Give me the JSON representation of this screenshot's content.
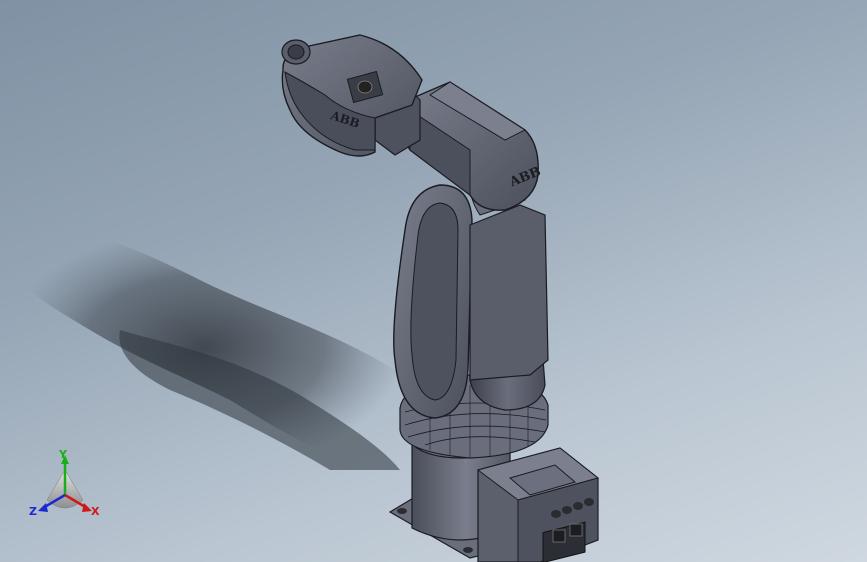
{
  "viewport": {
    "background_top": "#7f91a3",
    "background_bottom": "#cfd8e0"
  },
  "model": {
    "brand_upper_arm": "ABB",
    "brand_wrist": "ABB",
    "body_color": "#5a5e6b",
    "edge_color": "#1a1c22"
  },
  "triad": {
    "x_label": "X",
    "y_label": "Y",
    "z_label": "Z",
    "x_color": "#d01818",
    "y_color": "#18b018",
    "z_color": "#1a2ad0"
  }
}
